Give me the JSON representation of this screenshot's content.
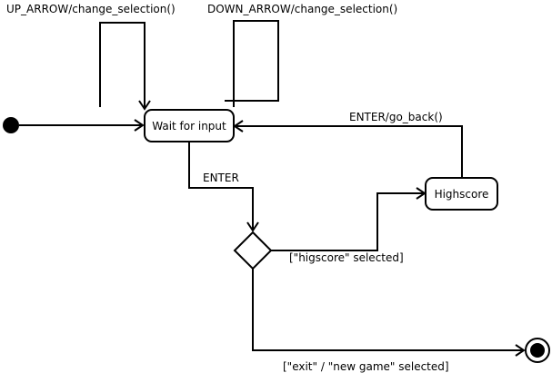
{
  "states": {
    "wait": "Wait for input",
    "highscore": "Highscore"
  },
  "transitions": {
    "up_arrow": "UP_ARROW/change_selection()",
    "down_arrow": "DOWN_ARROW/change_selection()",
    "enter": "ENTER",
    "enter_go_back": "ENTER/go_back()"
  },
  "guards": {
    "highscore_selected": "[\"higscore\" selected]",
    "exit_or_new_game": "[\"exit\" / \"new game\" selected]"
  }
}
